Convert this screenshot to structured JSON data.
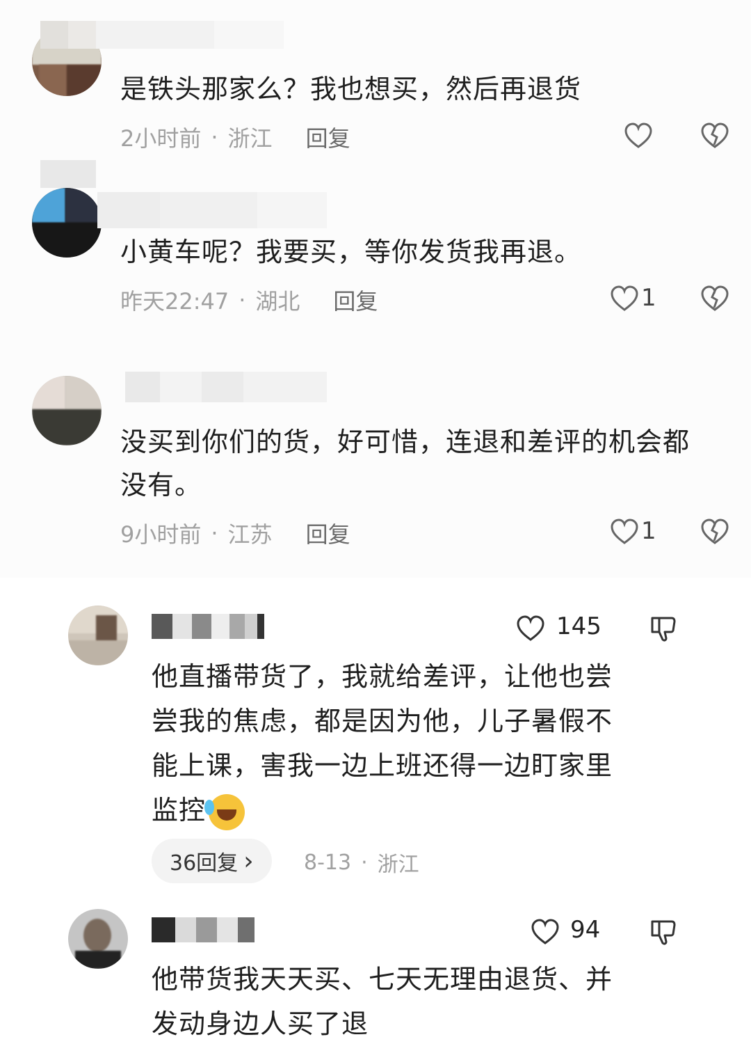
{
  "comments_top": [
    {
      "text": "是铁头那家么？我也想买，然后再退货",
      "time": "2小时前",
      "location": "浙江",
      "reply": "回复",
      "likes": ""
    },
    {
      "text": "小黄车呢？我要买，等你发货我再退。",
      "time": "昨天22:47",
      "location": "湖北",
      "reply": "回复",
      "likes": "1"
    },
    {
      "text_line1": "没买到你们的货，好可惜，连退和差评的机会都",
      "text_line2": "没有。",
      "time": "9小时前",
      "location": "江苏",
      "reply": "回复",
      "likes": "1"
    }
  ],
  "comments_bottom": [
    {
      "likes": "145",
      "lines": [
        "他直播带货了，我就给差评，让他也尝",
        "尝我的焦虑，都是因为他，儿子暑假不",
        "能上课，害我一边上班还得一边盯家里",
        "监控"
      ],
      "emoji": "laughing-crying-emoji",
      "replies": "36回复",
      "date": "8-13",
      "location": "浙江"
    },
    {
      "likes": "94",
      "lines": [
        "他带货我天天买、七天无理由退货、并",
        "发动身边人买了退"
      ]
    }
  ],
  "separator": "·",
  "chevron": "›",
  "icons": [
    "heart-icon",
    "broken-heart-icon",
    "thumbs-down-icon",
    "chevron-right-icon"
  ]
}
